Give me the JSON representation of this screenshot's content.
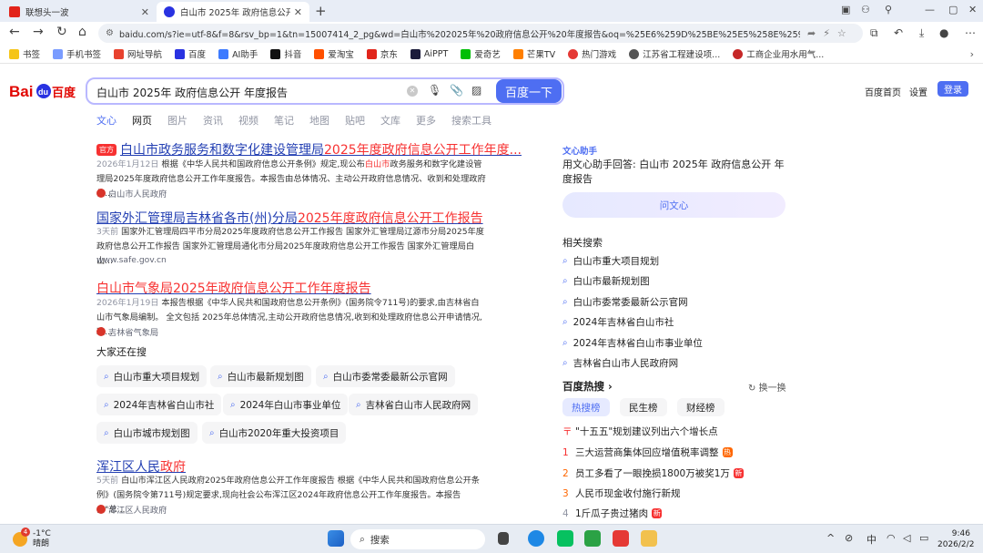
{
  "browser": {
    "tabs": [
      {
        "title": "联想头一波",
        "active": false
      },
      {
        "title": "白山市 2025年 政府信息公开 年度",
        "active": true
      }
    ],
    "new_tab": "+",
    "url": "baidu.com/s?ie=utf-8&f=8&rsv_bp=1&tn=15007414_2_pg&wd=白山市%202025年%20政府信息公开%20年度报告&oq=%25E6%259D%25BE%25E5%258E%259F%25E5%25B8%2582%...",
    "bookmarks": [
      "书签",
      "手机书签",
      "网址导航",
      "百度",
      "AI助手",
      "抖音",
      "爱淘宝",
      "京东",
      "AiPPT",
      "爱奇艺",
      "芒果TV",
      "热门游戏",
      "江苏省工程建设项...",
      "工商企业用水用气..."
    ]
  },
  "baidu": {
    "logo_text": "Bai du 百度",
    "query": "白山市 2025年 政府信息公开 年度报告",
    "search_button": "百度一下",
    "header_links": [
      "百度首页",
      "设置"
    ],
    "login": "登录",
    "categories": [
      "文心",
      "网页",
      "图片",
      "资讯",
      "视频",
      "笔记",
      "地图",
      "贴吧",
      "文库",
      "更多",
      "搜索工具"
    ]
  },
  "results": [
    {
      "badge": "官方",
      "title_pre": "白山市政务服务和数字化建设管理局",
      "title_hl": "2025年度政府信息公开工作",
      "title_post": "年度...",
      "date": "2026年1月12日",
      "snippet_a": "根据《中华人民共和国政府信息公开条例》规定,现公布",
      "snippet_hl": "白山市",
      "snippet_b": "政务服务和数字化建设管理局2025年度政府信息公开工作年度报告。本报告由总体情况、主动公开政府信息情况、收到和处理政府信...",
      "source": "白山市人民政府"
    },
    {
      "title_pre": "国家外汇管理局吉林省各市(州)分局",
      "title_hl": "2025年度政府信息公开工作",
      "title_post": "报告",
      "date": "3天前",
      "snippet": "国家外汇管理局四平市分局2025年度政府信息公开工作报告 国家外汇管理局辽源市分局2025年度政府信息公开工作报告 国家外汇管理局通化市分局2025年度政府信息公开工作报告 国家外汇管理局白山...",
      "source": "www.safe.gov.cn"
    },
    {
      "title_pre": "白山市气象局",
      "title_hl": "2025年政府信息公开工作年度报告",
      "date": "2026年1月19日",
      "snippet_a": "本报告根据《中华人民共和国政府信息公开条例》(国务院令711号)的要求,由吉林省白山市气象局编制。 全文包括 2025年总体情况,主动公开政府信息情况,收到和处理政府信息公开申请情况,政...",
      "source": "吉林省气象局"
    },
    {
      "title_pre": "浑江区人民",
      "title_hl": "政府",
      "date": "5天前",
      "snippet_a": "白山市浑江区人民政府2025年政府信息公开工作年度报告 根据《中华人民共和国政府信息公开条例》(国务院令第711号)规定要求,现向社会公布浑江区2024年政府信息公开工作年度报告。本报告由\"总...",
      "source": "浑江区人民政府"
    }
  ],
  "people_also_search": {
    "title": "大家还在搜",
    "items": [
      "白山市重大项目规划",
      "白山市最新规划图",
      "白山市委常委最新公示官网",
      "2024年吉林省白山市社",
      "2024年白山市事业单位",
      "吉林省白山市人民政府网",
      "白山市城市规划图",
      "白山市2020年重大投资项目"
    ]
  },
  "sidebar": {
    "assistant_head": "文心助手",
    "assistant_text": "用文心助手回答: 白山市 2025年 政府信息公开 年度报告",
    "assistant_button": "问文心",
    "related_title": "相关搜索",
    "related": [
      "白山市重大项目规划",
      "白山市最新规划图",
      "白山市委常委最新公示官网",
      "2024年吉林省白山市社",
      "2024年吉林省白山市事业单位",
      "吉林省白山市人民政府网"
    ],
    "hot_title": "百度热搜",
    "refresh": "换一换",
    "hot_tabs": [
      "热搜榜",
      "民生榜",
      "财经榜"
    ],
    "hot_items": [
      {
        "num": "〒",
        "text": "\"十五五\"规划建议列出六个增长点",
        "badge": ""
      },
      {
        "num": "1",
        "text": "三大运营商集体回应增值税率调整",
        "badge": "热"
      },
      {
        "num": "2",
        "text": "员工多看了一眼挽损1800万被奖1万",
        "badge": "新"
      },
      {
        "num": "3",
        "text": "人民币现金收付施行新规",
        "badge": ""
      },
      {
        "num": "4",
        "text": "1斤瓜子贵过猪肉",
        "badge": "新"
      }
    ]
  },
  "taskbar": {
    "temperature": "-1°C",
    "weather": "晴朗",
    "weather_badge": "4",
    "search": "搜索",
    "ime": "中",
    "time": "9:46",
    "date": "2026/2/2"
  },
  "colors": {
    "accent": "#4e6ef2",
    "link": "#2440b3",
    "highlight": "#f73131"
  }
}
